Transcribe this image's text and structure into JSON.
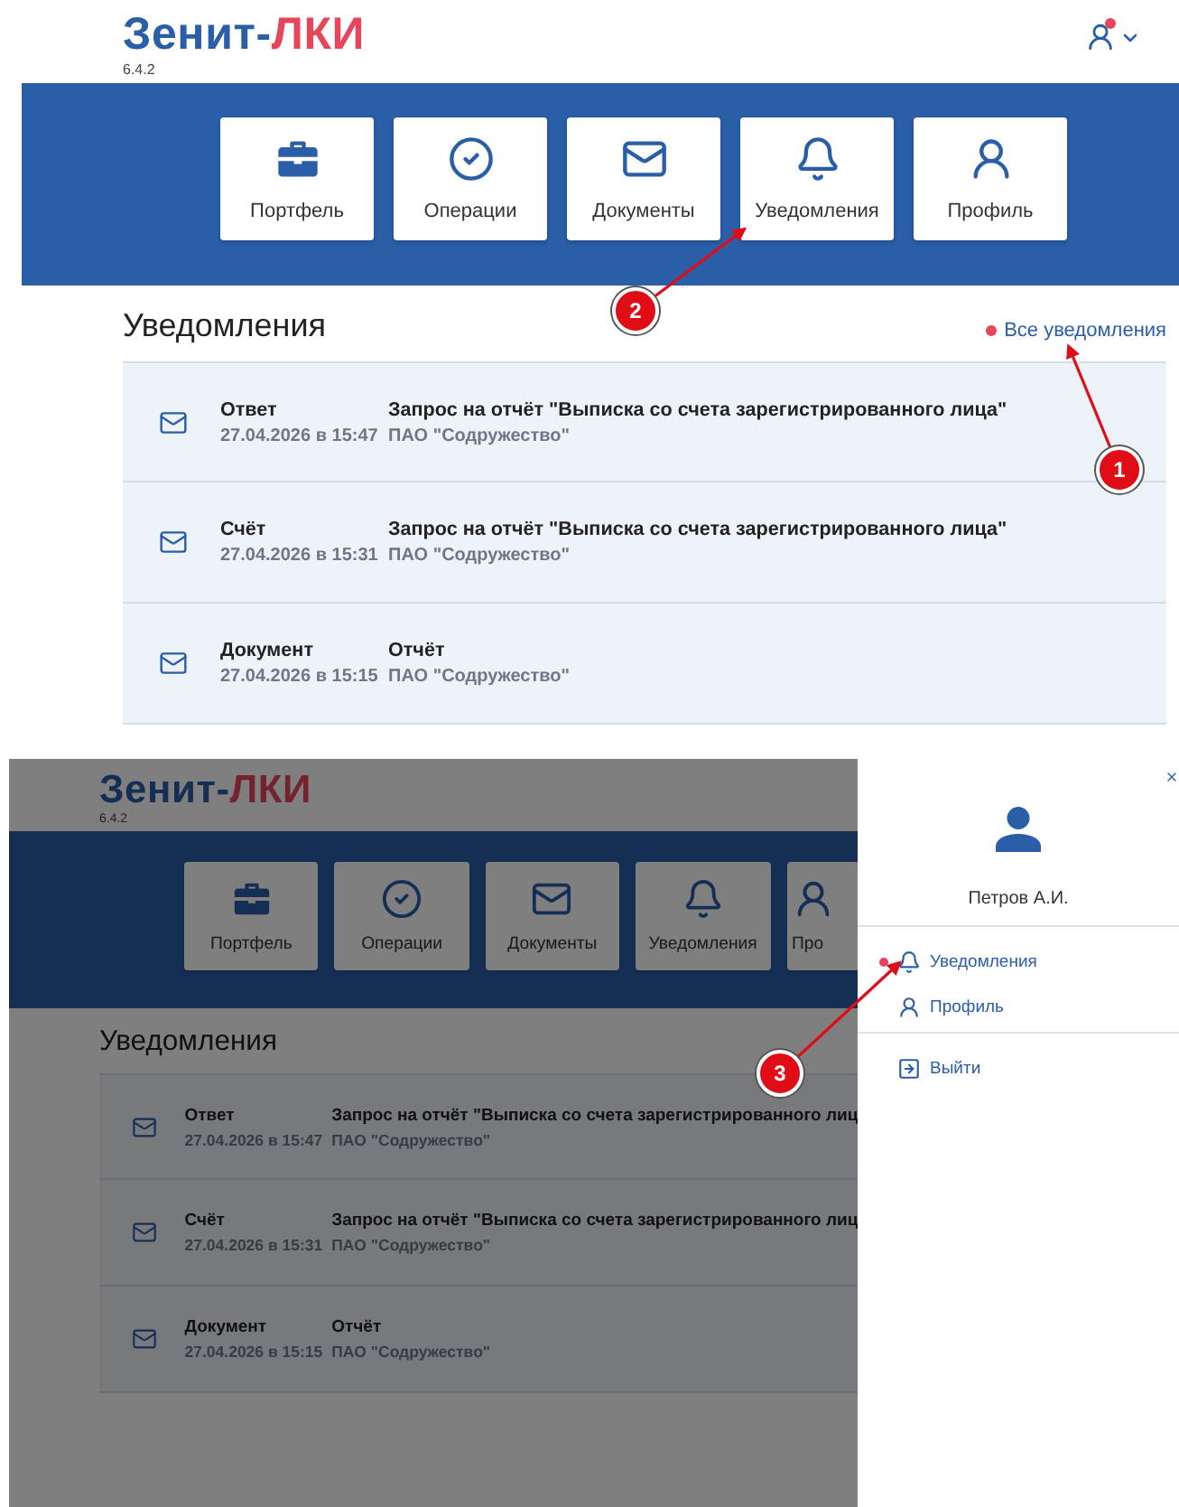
{
  "screens": [
    {
      "logo": {
        "main": "Зенит-",
        "accent": "ЛКИ"
      },
      "version": "6.4.2",
      "user_menu": {
        "has_unread": true
      },
      "tiles": [
        {
          "label": "Портфель"
        },
        {
          "label": "Операции"
        },
        {
          "label": "Документы"
        },
        {
          "label": "Уведомления"
        },
        {
          "label": "Профиль"
        }
      ],
      "section_title": "Уведомления",
      "all_link": {
        "label": "Все уведомления",
        "has_unread": true
      },
      "notifications": [
        {
          "type": "Ответ",
          "date": "27.04.2026 в 15:47",
          "subject": "Запрос на отчёт \"Выписка со счета зарегистрированного лица\"",
          "sender": "ПАО \"Содружество\""
        },
        {
          "type": "Счёт",
          "date": "27.04.2026 в 15:31",
          "subject": "Запрос на отчёт \"Выписка со счета зарегистрированного лица\"",
          "sender": "ПАО \"Содружество\""
        },
        {
          "type": "Документ",
          "date": "27.04.2026 в 15:15",
          "subject": "Отчёт",
          "sender": "ПАО \"Содружество\""
        }
      ],
      "callouts": [
        {
          "number": "2"
        },
        {
          "number": "1"
        }
      ]
    },
    {
      "logo": {
        "main": "Зенит-",
        "accent": "ЛКИ"
      },
      "version": "6.4.2",
      "tiles": [
        {
          "label": "Портфель"
        },
        {
          "label": "Операции"
        },
        {
          "label": "Документы"
        },
        {
          "label": "Уведомления"
        },
        {
          "label": "Про"
        }
      ],
      "section_title": "Уведомления",
      "notifications": [
        {
          "type": "Ответ",
          "date": "27.04.2026 в 15:47",
          "subject": "Запрос на отчёт \"Выписка со счета зарегистрированного лиц",
          "sender": "ПАО \"Содружество\""
        },
        {
          "type": "Счёт",
          "date": "27.04.2026 в 15:31",
          "subject": "Запрос на отчёт \"Выписка со счета зарегистрированного лиц",
          "sender": "ПАО \"Содружество\""
        },
        {
          "type": "Документ",
          "date": "27.04.2026 в 15:15",
          "subject": "Отчёт",
          "sender": "ПАО \"Содружество\""
        }
      ],
      "dimmed": true,
      "drawer": {
        "user_name": "Петров А.И.",
        "groups": [
          [
            {
              "label": "Уведомления",
              "has_unread": true
            },
            {
              "label": "Профиль",
              "has_unread": false
            }
          ],
          [
            {
              "label": "Выйти",
              "has_unread": false
            }
          ]
        ]
      },
      "callouts": [
        {
          "number": "3"
        }
      ]
    }
  ]
}
